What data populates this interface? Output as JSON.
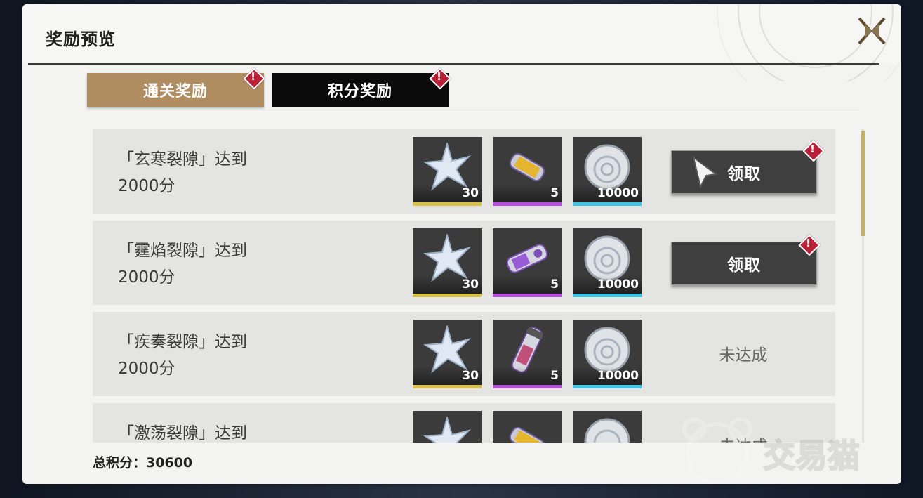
{
  "title": "奖励预览",
  "tabs": [
    {
      "label": "通关奖励",
      "active": true,
      "alert": true
    },
    {
      "label": "积分奖励",
      "active": false,
      "alert": true
    }
  ],
  "rows": [
    {
      "title_line1": "「玄寒裂隙」达到",
      "title_line2": "2000分",
      "rewards": [
        {
          "icon": "star-crystal-icon",
          "qty": "30"
        },
        {
          "icon": "gold-capsule-icon",
          "qty": "5"
        },
        {
          "icon": "silver-coin-icon",
          "qty": "10000"
        }
      ],
      "action": "领取",
      "claimable": true
    },
    {
      "title_line1": "「霆焰裂隙」达到",
      "title_line2": "2000分",
      "rewards": [
        {
          "icon": "star-crystal-icon",
          "qty": "30"
        },
        {
          "icon": "purple-capsule-icon",
          "qty": "5"
        },
        {
          "icon": "silver-coin-icon",
          "qty": "10000"
        }
      ],
      "action": "领取",
      "claimable": true
    },
    {
      "title_line1": "「疾奏裂隙」达到",
      "title_line2": "2000分",
      "rewards": [
        {
          "icon": "star-crystal-icon",
          "qty": "30"
        },
        {
          "icon": "vial-icon",
          "qty": "5"
        },
        {
          "icon": "silver-coin-icon",
          "qty": "10000"
        }
      ],
      "action": "未达成",
      "claimable": false
    },
    {
      "title_line1": "「激荡裂隙」达到",
      "title_line2": "",
      "rewards": [
        {
          "icon": "star-crystal-icon",
          "qty": ""
        },
        {
          "icon": "gold-capsule-icon",
          "qty": ""
        },
        {
          "icon": "silver-coin-icon",
          "qty": ""
        }
      ],
      "action": "未达成",
      "claimable": false
    }
  ],
  "total_label": "总积分：30600",
  "watermark": "交易猫",
  "colors": {
    "active_tab": "#b08c61",
    "alert": "#b82137",
    "bar_yellow": "#d8c24a",
    "bar_purple": "#b64ee0",
    "bar_cyan": "#3fc4e6"
  }
}
